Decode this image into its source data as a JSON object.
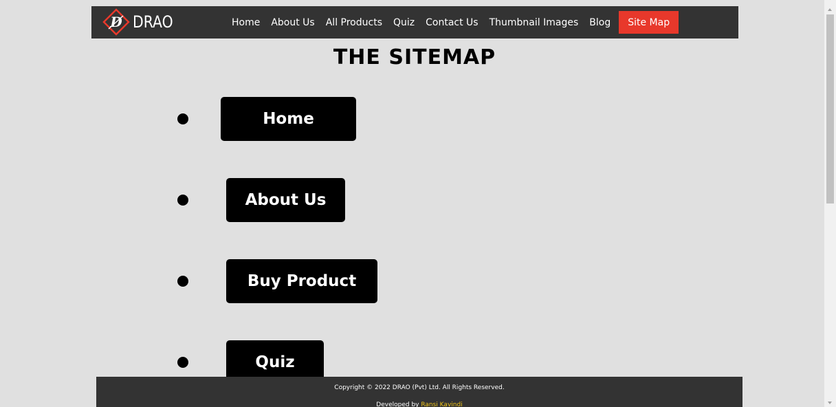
{
  "navbar": {
    "logo_text": "DRAO",
    "links": [
      {
        "label": "Home"
      },
      {
        "label": "About Us"
      },
      {
        "label": "All Products"
      },
      {
        "label": "Quiz"
      },
      {
        "label": "Contact Us"
      },
      {
        "label": "Thumbnail Images"
      },
      {
        "label": "Blog"
      },
      {
        "label": "Site Map",
        "active": true
      }
    ],
    "background_color": "#333333",
    "active_color": "#e8382b"
  },
  "page_title": "THE SITEMAP",
  "sitemap": [
    {
      "label": "Home"
    },
    {
      "label": "About Us"
    },
    {
      "label": "Buy Product"
    },
    {
      "label": "Quiz"
    }
  ],
  "footer": {
    "copyright": "Copyright © 2022 DRAO (Pvt) Ltd. All Rights Reserved.",
    "developed_by_prefix": "Developed by ",
    "developer_name": "Ransi Kavindi"
  },
  "colors": {
    "page_background": "#e0e0e0",
    "button_background": "#000000",
    "developer_link": "#f0c419"
  },
  "icons": [
    "drao-logo-icon",
    "bullet-icon",
    "scroll-up-arrow-icon",
    "scroll-down-arrow-icon"
  ]
}
